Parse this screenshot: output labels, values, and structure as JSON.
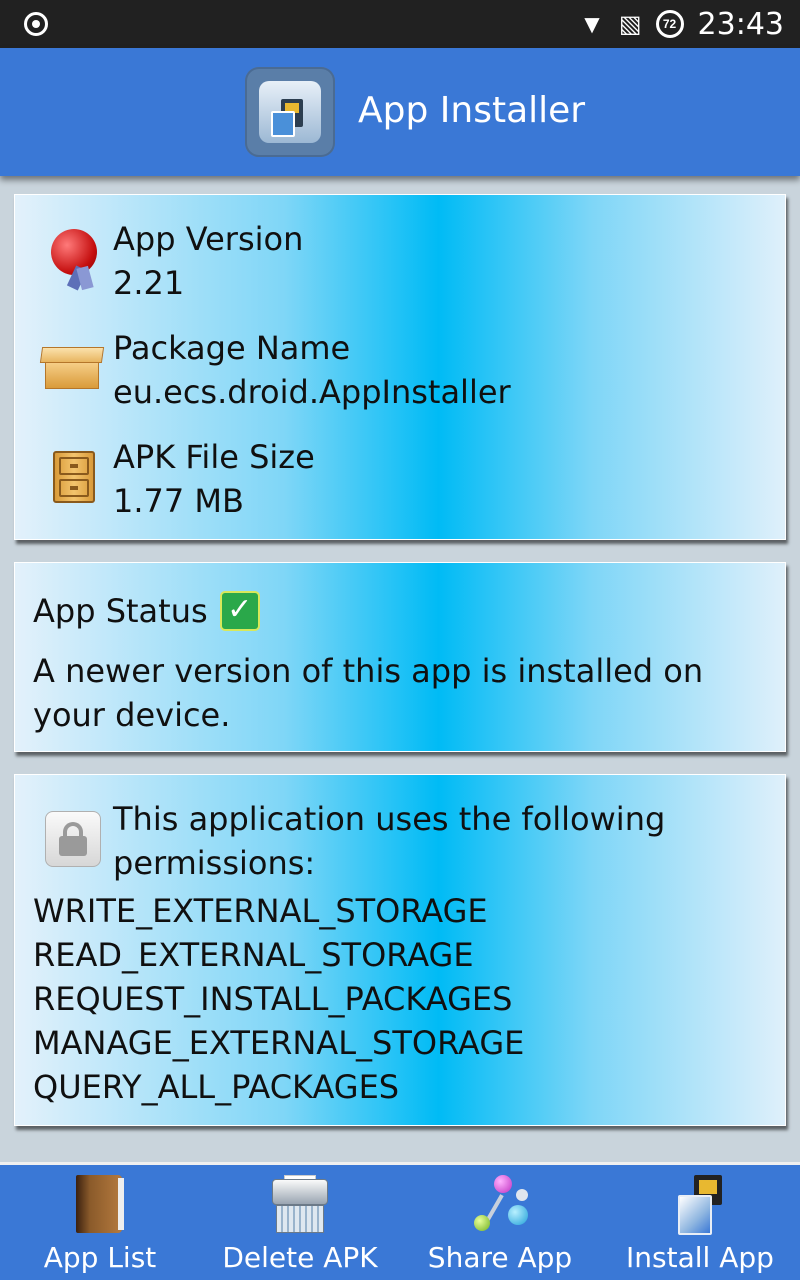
{
  "status_bar": {
    "time": "23:43",
    "battery": "72"
  },
  "header": {
    "title": "App Installer"
  },
  "info": {
    "version_label": "App Version",
    "version_value": "2.21",
    "package_label": "Package Name",
    "package_value": "eu.ecs.droid.AppInstaller",
    "size_label": "APK File Size",
    "size_value": "1.77 MB"
  },
  "status": {
    "title": "App Status",
    "message": "A newer version of this app is installed on your device."
  },
  "permissions": {
    "intro": "This application uses the following permissions:",
    "items": [
      "WRITE_EXTERNAL_STORAGE",
      "READ_EXTERNAL_STORAGE",
      "REQUEST_INSTALL_PACKAGES",
      "MANAGE_EXTERNAL_STORAGE",
      "QUERY_ALL_PACKAGES"
    ]
  },
  "bottom_nav": {
    "items": [
      {
        "label": "App List",
        "icon": "book-icon"
      },
      {
        "label": "Delete APK",
        "icon": "shredder-icon"
      },
      {
        "label": "Share App",
        "icon": "share-icon"
      },
      {
        "label": "Install App",
        "icon": "sd-card-icon"
      }
    ]
  },
  "colors": {
    "header": "#3a78d6",
    "card_accent": "#00bbf5",
    "status_bar": "#212121"
  }
}
